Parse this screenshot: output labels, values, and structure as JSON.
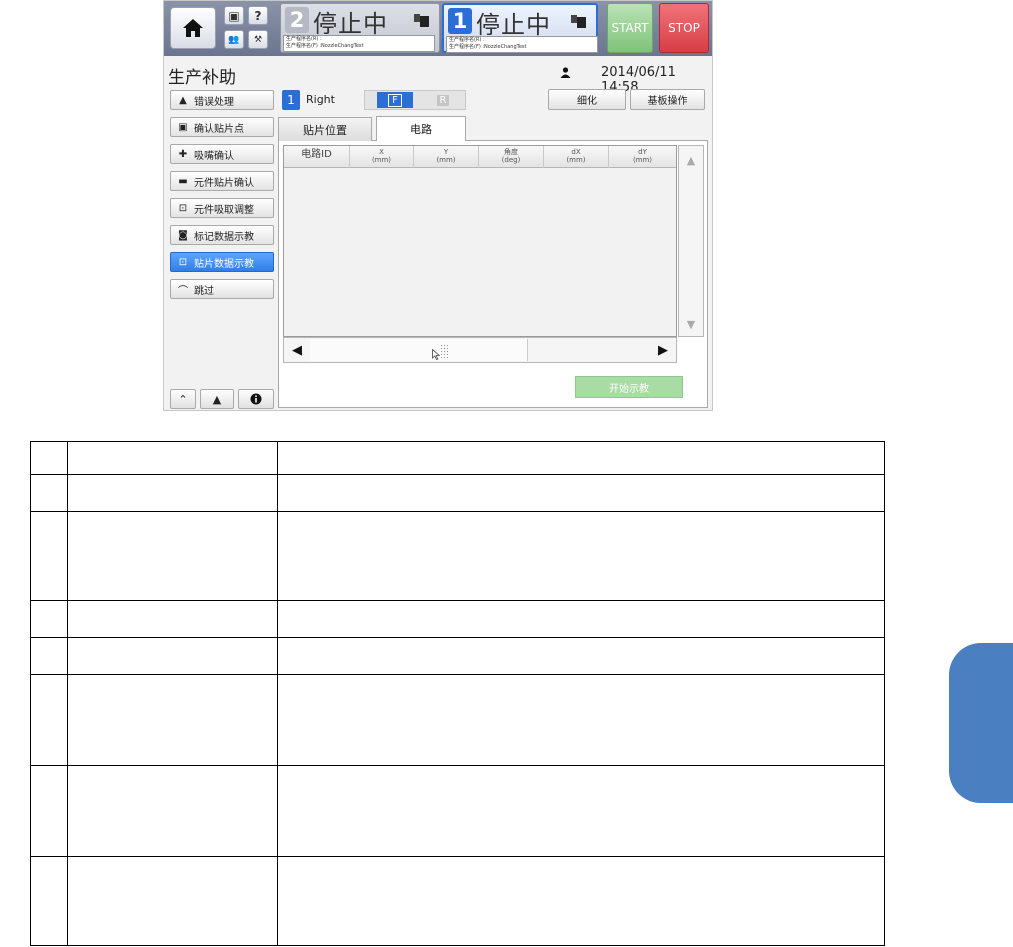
{
  "header": {
    "home_icon": "home-icon",
    "lane2": {
      "number": "2",
      "status": "停止中",
      "info_line1": "生产程序名(R) :",
      "info_line2": "生产程序名(F) :NozzleChangTest"
    },
    "lane1": {
      "number": "1",
      "status": "停止中",
      "info_line1": "生产程序名(R) :",
      "info_line2": "生产程序名(F) :NozzleChangTest"
    },
    "start_label": "START",
    "stop_label": "STOP",
    "small_q": "?"
  },
  "title": "生产补助",
  "datetime": "2014/06/11 14:58",
  "menu": [
    {
      "label": "错误处理",
      "icon": "warning-gear-icon"
    },
    {
      "label": "确认贴片点",
      "icon": "monitor-check-icon"
    },
    {
      "label": "吸嘴确认",
      "icon": "nozzle-search-icon"
    },
    {
      "label": "元件贴片确认",
      "icon": "component-mount-icon"
    },
    {
      "label": "元件吸取调整",
      "icon": "pickup-adjust-icon"
    },
    {
      "label": "标记数据示教",
      "icon": "mark-teach-icon"
    },
    {
      "label": "贴片数据示教",
      "icon": "mount-teach-icon"
    },
    {
      "label": "跳过",
      "icon": "skip-icon"
    }
  ],
  "side": {
    "number": "1",
    "label": "Right",
    "front": "F",
    "rear": "R"
  },
  "buttons": {
    "detail": "细化",
    "board_op": "基板操作",
    "start_teach": "开始示教"
  },
  "tabs": [
    {
      "label": "贴片位置"
    },
    {
      "label": "电路"
    }
  ],
  "columns": [
    {
      "name": "电路ID",
      "unit": ""
    },
    {
      "name": "X",
      "unit": "(mm)"
    },
    {
      "name": "Y",
      "unit": "(mm)"
    },
    {
      "name": "角度",
      "unit": "(deg)"
    },
    {
      "name": "dX",
      "unit": "(mm)"
    },
    {
      "name": "dY",
      "unit": "(mm)"
    }
  ]
}
